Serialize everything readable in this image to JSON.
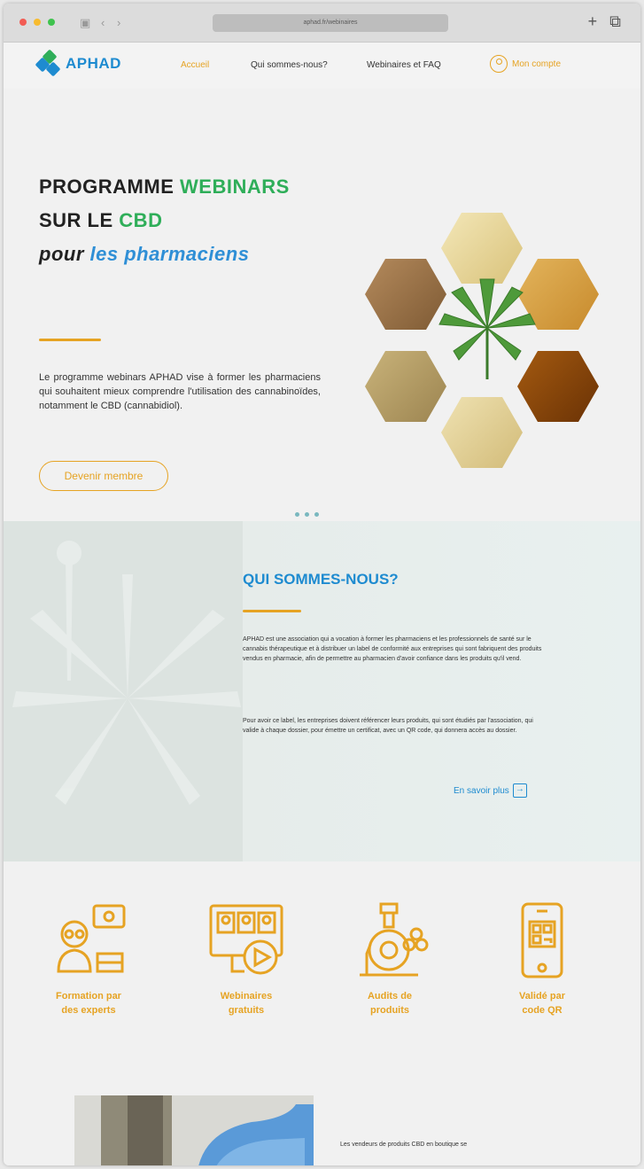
{
  "browser": {
    "url": "aphad.fr/webinaires"
  },
  "nav": {
    "logo_text": "APHAD",
    "logo_subtitle": "",
    "links": [
      "Accueil",
      "Qui sommes-nous?",
      "Webinaires et FAQ"
    ],
    "account_label": "Mon compte"
  },
  "hero": {
    "title_line1_a": "PROGRAMME ",
    "title_line1_b": "WEBINARS",
    "title_line2_a": "SUR LE ",
    "title_line2_b": "CBD",
    "title_line3_a": "pour ",
    "title_line3_b": "les pharmaciens",
    "text": "Le programme webinars APHAD vise à former les pharmaciens qui souhaitent mieux comprendre l'utilisation des cannabinoïdes, notamment le CBD (cannabidiol).",
    "cta": "Devenir membre"
  },
  "about": {
    "title": "QUI SOMMES-NOUS?",
    "paragraph1": "APHAD est une association qui a vocation à former les pharmaciens et les professionnels de santé sur le cannabis thérapeutique et à distribuer un label de conformité aux entreprises qui sont fabriquent des produits vendus en pharmacie, afin de permettre au pharmacien d'avoir confiance dans les produits qu'il vend.",
    "paragraph2": "Pour avoir ce label, les entreprises doivent référencer leurs produits, qui sont étudiés par l'association, qui valide à chaque dossier, pour émettre un certificat, avec un QR code, qui donnera accès au dossier.",
    "more": "En savoir plus"
  },
  "features": [
    {
      "line1": "Formation par",
      "line2": "des experts"
    },
    {
      "line1": "Webinaires",
      "line2": "gratuits"
    },
    {
      "line1": "Audits de",
      "line2": "produits"
    },
    {
      "line1": "Validé par",
      "line2": "code QR"
    }
  ],
  "bottom": {
    "text": "Les vendeurs de produits CBD en boutique se"
  },
  "colors": {
    "accent_orange": "#e6a323",
    "brand_blue": "#1e8bd0",
    "brand_green": "#2fae59"
  }
}
